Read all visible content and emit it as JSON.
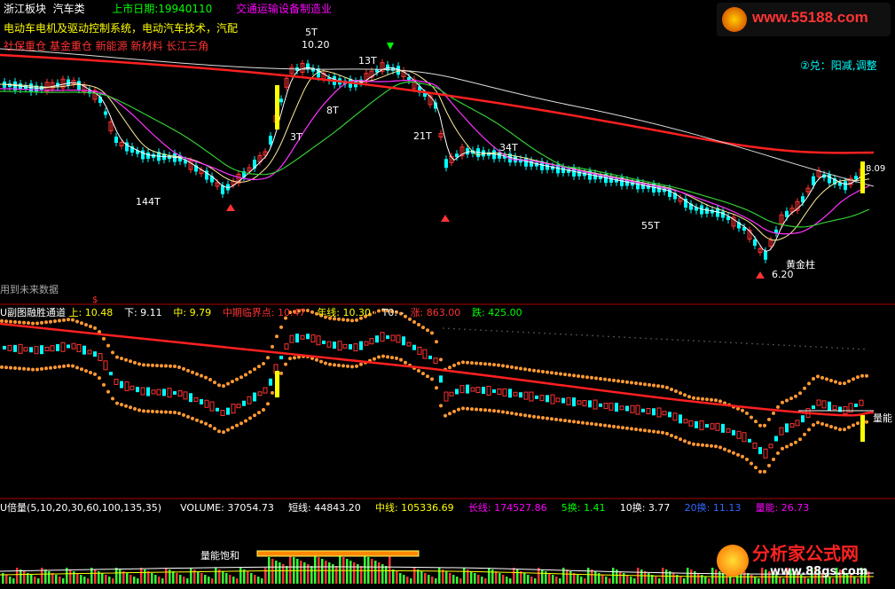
{
  "header": {
    "sector": "浙江板块",
    "industry": "汽车类",
    "listing": "上市日期:19940110",
    "category": "交通运输设备制造业",
    "concepts1": "电动车电机及驱动控制系统，电动汽车技术，汽配",
    "concepts2": "社保重仓 基金重仓 新能源 新材料 长江三角",
    "logo_text": "www.55188.com",
    "signal": "②兑：阳减,调整"
  },
  "main_chart": {
    "annotations": [
      "5T",
      "10.20",
      "13T",
      "8T",
      "3T",
      "21T",
      "34T",
      "144T",
      "55T",
      "黄金柱",
      "6.20",
      "8.09",
      "用到未来数据",
      "$"
    ],
    "price_high": "10.20",
    "price_low": "6.20",
    "price_right": "8.09"
  },
  "sub_chart": {
    "label": "U副图融胜通道",
    "up_label": "上: 10.48",
    "down_label": "下: 9.11",
    "mid_label": "中: 9.79",
    "critical_label": "中期临界点: 10.47",
    "year_label": "年线: 10.30",
    "t0_label": "T0: -",
    "rise_label": "涨: 863.00",
    "fall_label": "跌: 425.00",
    "right_tag": "量能"
  },
  "volume_chart": {
    "label": "U倍量(5,10,20,30,60,100,135,35)",
    "volume": "VOLUME: 37054.73",
    "short_line": "短线: 44843.20",
    "mid_line": "中线: 105336.69",
    "long_line": "长线: 174527.86",
    "turn5": "5换: 1.41",
    "turn10": "10换: 3.77",
    "turn20": "20换: 11.13",
    "energy": "量能: 26.73",
    "saturation": "量能饱和",
    "watermark": "分析家公式网",
    "watermark_url": "www.88gs.com"
  },
  "colors": {
    "up": "#ff3333",
    "down": "#00ffff",
    "ma_red": "#ff2020",
    "ma_magenta": "#ff33ff",
    "ma_green": "#33cc33",
    "ma_white": "#ffffff",
    "dots": "#ff9933",
    "accent_yellow": "#ffff00"
  }
}
